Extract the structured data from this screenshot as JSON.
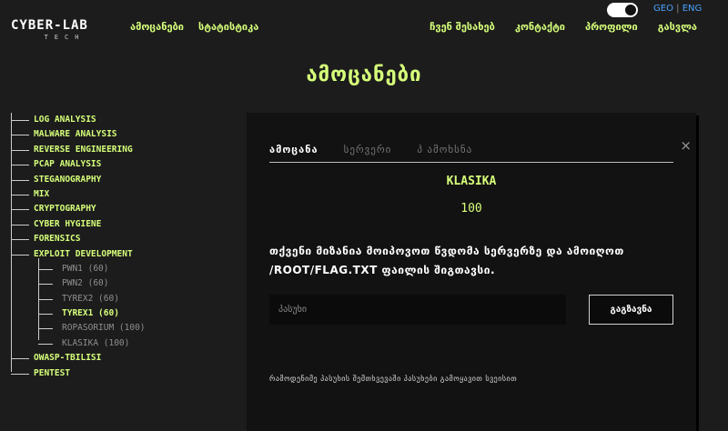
{
  "logo": {
    "main": "CYBER-LAB",
    "sub": "TECH"
  },
  "nav": {
    "left": [
      "ამოცანები",
      "სტატისტიკა"
    ],
    "right": [
      "ჩვენ შესახებ",
      "კონტაქტი",
      "პროფილი",
      "გასვლა"
    ]
  },
  "lang": {
    "geo": "GEO",
    "sep": "|",
    "eng": "ENG"
  },
  "page_title": "ამოცანები",
  "categories": [
    "LOG ANALYSIS",
    "MALWARE ANALYSIS",
    "REVERSE ENGINEERING",
    "PCAP ANALYSIS",
    "STEGANOGRAPHY",
    "MIX",
    "CRYPTOGRAPHY",
    "CYBER HYGIENE",
    "FORENSICS",
    "EXPLOIT DEVELOPMENT",
    "OWASP-TBILISI",
    "PENTEST"
  ],
  "exploit_tasks": [
    "PWN1 (60)",
    "PWN2 (60)",
    "TYREX2 (60)",
    "TYREX1 (60)",
    "ROPASORIUM (100)",
    "KLASIKA (100)"
  ],
  "modal": {
    "tabs": [
      "ამოცანა",
      "სერვერი",
      "პ ამოხსნა"
    ],
    "close": "×",
    "task_name": "KLASIKA",
    "points": "100",
    "description_line1": "თქვენი მიზანია მოიპოვოთ წვდომა სერვერზე და ამოიღოთ",
    "description_line2": "/ROOT/FLAG.TXT ფაილის შიგთავსი.",
    "answer_placeholder": "პასუხი",
    "submit_label": "გაგზავნა",
    "footnote": "რამოდენიმე პასუხის შემთხვევაში პასუხები გამოყავით სვეისით"
  },
  "colors": {
    "accent": "#d6ff7a",
    "background": "#1c1c1c",
    "panel": "#121212",
    "link": "#4aa3ff"
  }
}
